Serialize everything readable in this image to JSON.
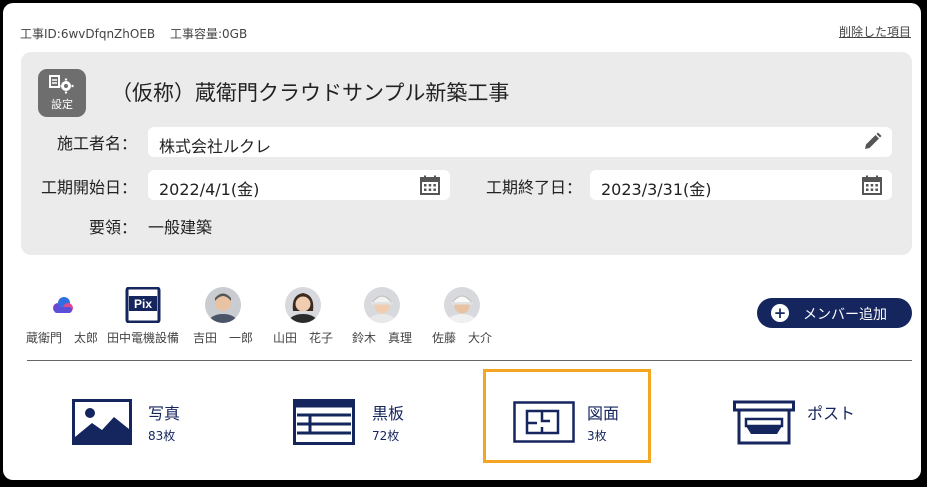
{
  "header": {
    "construction_id": "工事ID:6wvDfqnZhOEB",
    "capacity": "工事容量:0GB",
    "deleted_items_link": "削除した項目"
  },
  "project": {
    "settings_label": "設定",
    "title": "（仮称）蔵衛門クラウドサンプル新築工事",
    "contractor_label": "施工者名：",
    "contractor_value": "株式会社ルクレ",
    "start_label": "工期開始日：",
    "start_value": "2022/4/1(金)",
    "end_label": "工期終了日：",
    "end_value": "2023/3/31(金)",
    "type_label": "要領：",
    "type_value": "一般建築"
  },
  "members": [
    {
      "name": "蔵衛門　太郎",
      "icon": "kuraemon-logo-icon"
    },
    {
      "name": "田中電機設備",
      "icon": "pix-logo-icon"
    },
    {
      "name": "吉田　一郎",
      "icon": "avatar"
    },
    {
      "name": "山田　花子",
      "icon": "avatar"
    },
    {
      "name": "鈴木　真理",
      "icon": "avatar"
    },
    {
      "name": "佐藤　大介",
      "icon": "avatar"
    }
  ],
  "add_member_label": "メンバー追加",
  "tiles": [
    {
      "title": "写真",
      "count": "83枚",
      "icon": "photo-icon"
    },
    {
      "title": "黒板",
      "count": "72枚",
      "icon": "blackboard-icon"
    },
    {
      "title": "図面",
      "count": "3枚",
      "icon": "drawing-icon"
    },
    {
      "title": "ポスト",
      "count": "",
      "icon": "post-tray-icon"
    }
  ],
  "colors": {
    "navy": "#15255e",
    "highlight": "#f4a623",
    "card_bg": "#ebebeb"
  }
}
